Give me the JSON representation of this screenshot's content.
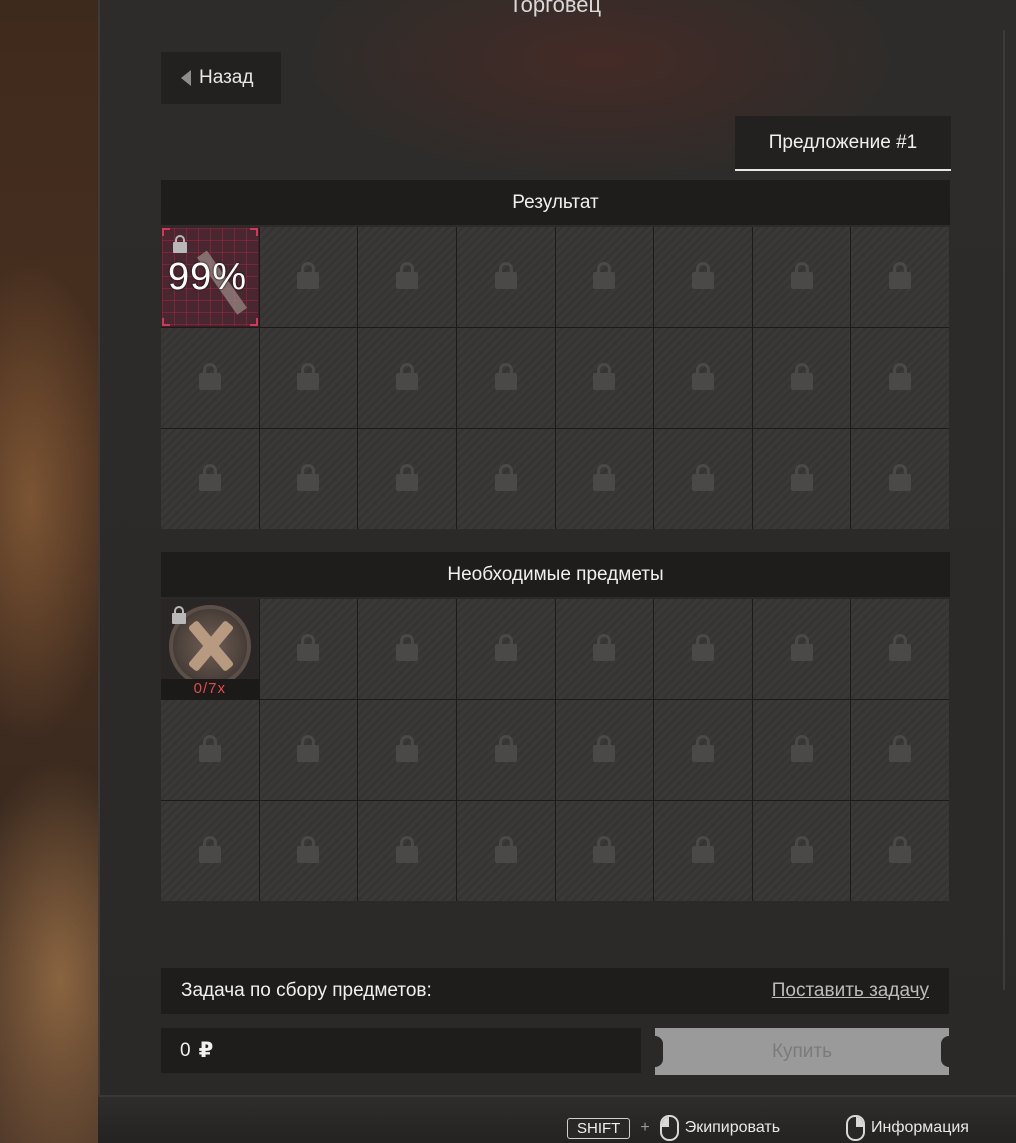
{
  "window": {
    "title": "Торговец"
  },
  "nav": {
    "back_label": "Назад"
  },
  "offer_tab": {
    "label": "Предложение #1"
  },
  "result": {
    "header": "Результат",
    "item": {
      "chance": "99%",
      "locked": true,
      "icon": "weapon-icon"
    },
    "locked_slot_icon": "lock-icon"
  },
  "required": {
    "header": "Необходимые предметы",
    "item": {
      "count": "0/7x",
      "locked": true,
      "icon": "crossed-tools-medal-icon"
    },
    "locked_slot_icon": "lock-icon"
  },
  "task": {
    "label": "Задача по сбору предметов:",
    "action": "Поставить задачу"
  },
  "price": {
    "amount": "0",
    "currency": "₽"
  },
  "buy": {
    "label": "Купить"
  },
  "hints": {
    "shift_key": "SHIFT",
    "plus": "+",
    "equip_label": "Экипировать",
    "info_label": "Информация"
  },
  "colors": {
    "accent_red": "#d03a5a",
    "count_red": "#e34a4a",
    "panel_bg": "#2b2927",
    "header_bg": "#1e1d1c",
    "buy_disabled": "#9a9a9a"
  }
}
